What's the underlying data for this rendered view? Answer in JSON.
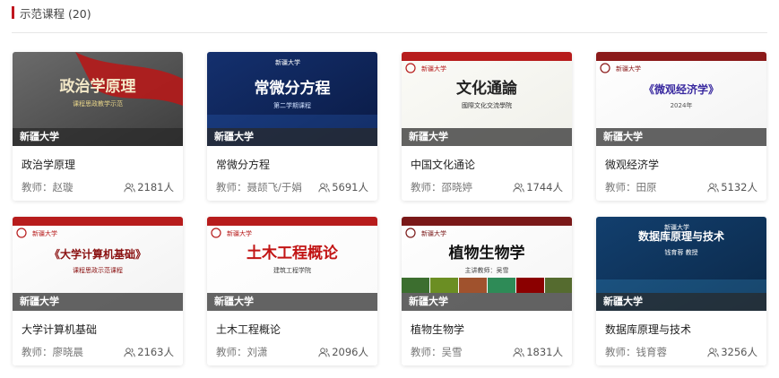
{
  "section": {
    "title": "示范课程 (20)"
  },
  "courses": [
    {
      "name": "政治学原理",
      "teacher": "教师：赵璇",
      "count": "2181人",
      "school": "新疆大学",
      "thumb": {
        "bg": "#6b6b6b",
        "bg2": "#3d3d3d",
        "accent": "#b51a1a",
        "art": "政治学原理",
        "art_color": "#f4e9c8",
        "sub": "课程思政教学示范",
        "sub_color": "#e7d489"
      }
    },
    {
      "name": "常微分方程",
      "teacher": "教师：聂颉飞/于娟",
      "count": "5691人",
      "school": "新疆大学",
      "thumb": {
        "bg": "#14306e",
        "bg2": "#0a1a44",
        "accent": "#2f6ad1",
        "art": "常微分方程",
        "art_color": "#ffffff",
        "sub": "第二学期课程",
        "sub_color": "#cfe0ff",
        "logo": "新疆大学"
      }
    },
    {
      "name": "中国文化通论",
      "teacher": "教师：邵晓婷",
      "count": "1744人",
      "school": "新疆大学",
      "thumb": {
        "bg": "#fbfbf7",
        "bg2": "#f0f0ea",
        "accent": "#b71c1c",
        "art": "文化通論",
        "art_color": "#222222",
        "sub": "國際文化交流學院",
        "sub_color": "#333333",
        "logo": "新疆大学"
      }
    },
    {
      "name": "微观经济学",
      "teacher": "教师：田原",
      "count": "5132人",
      "school": "新疆大学",
      "thumb": {
        "bg": "#ffffff",
        "bg2": "#f3f3f3",
        "accent": "#8b1a1a",
        "art": "《微观经济学》",
        "art_color": "#3a2aa0",
        "sub": "2024年",
        "sub_color": "#555555",
        "logo": "新疆大学"
      }
    },
    {
      "name": "大学计算机基础",
      "teacher": "教师：廖晓晨",
      "count": "2163人",
      "school": "新疆大学",
      "thumb": {
        "bg": "#ffffff",
        "bg2": "#f2f2f2",
        "accent": "#b71c1c",
        "art": "《大学计算机基础》",
        "art_color": "#8a1010",
        "sub": "课程思政示范课程",
        "sub_color": "#8a1010",
        "logo": "新疆大学"
      }
    },
    {
      "name": "土木工程概论",
      "teacher": "教师：刘潇",
      "count": "2096人",
      "school": "新疆大学",
      "thumb": {
        "bg": "#ffffff",
        "bg2": "#fafafa",
        "accent": "#b71c1c",
        "art": "土木工程概论",
        "art_color": "#c21515",
        "sub": "建筑工程学院",
        "sub_color": "#444444",
        "logo": "新疆大学"
      }
    },
    {
      "name": "植物生物学",
      "teacher": "教师：吴雪",
      "count": "1831人",
      "school": "新疆大学",
      "thumb": {
        "bg": "#ffffff",
        "bg2": "#f5f5f5",
        "accent": "#7a1818",
        "art": "植物生物学",
        "art_color": "#111111",
        "sub": "主讲教师：吴雪",
        "sub_color": "#444444",
        "logo": "新疆大学"
      }
    },
    {
      "name": "数据库原理与技术",
      "teacher": "教师：钱育蓉",
      "count": "3256人",
      "school": "新疆大学",
      "thumb": {
        "bg": "#123f6e",
        "bg2": "#0b2848",
        "accent": "#3aa0d8",
        "art": "数据库原理与技术",
        "art_color": "#ffffff",
        "sub": "钱育蓉 教授",
        "sub_color": "#ffffff",
        "logo": "新疆大学"
      }
    }
  ]
}
